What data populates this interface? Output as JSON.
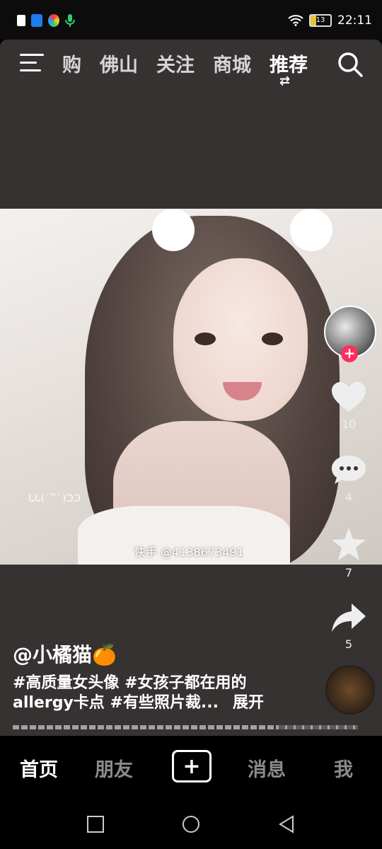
{
  "status_bar": {
    "time": "22:11",
    "battery_level": "13",
    "left_icons": [
      "alert-icon",
      "shield-app-icon",
      "colorful-app-icon",
      "microphone-icon"
    ],
    "right_icons": [
      "wifi-icon",
      "battery-icon"
    ]
  },
  "top_nav": {
    "tabs": [
      {
        "label": "购"
      },
      {
        "label": "佛山"
      },
      {
        "label": "关注"
      },
      {
        "label": "商城"
      },
      {
        "label": "推荐",
        "active": true
      }
    ],
    "swap_glyph": "⇄"
  },
  "video": {
    "watermark": "快手 @4138673491",
    "scribble": "ᒐᒐ(ˊ꒳ˋ)ᑐᑐ"
  },
  "actions": {
    "likes": "10",
    "comments": "4",
    "favorites": "7",
    "shares": "5"
  },
  "caption": {
    "author": "@小橘猫🍊",
    "text": "#高质量女头像 #女孩子都在用的allergy卡点 #有些照片裁...",
    "expand": "展开"
  },
  "progress": {
    "segments_watched_fraction": 0.77
  },
  "bottom_nav": {
    "home": "首页",
    "friends": "朋友",
    "create": "+",
    "messages": "消息",
    "me": "我"
  }
}
